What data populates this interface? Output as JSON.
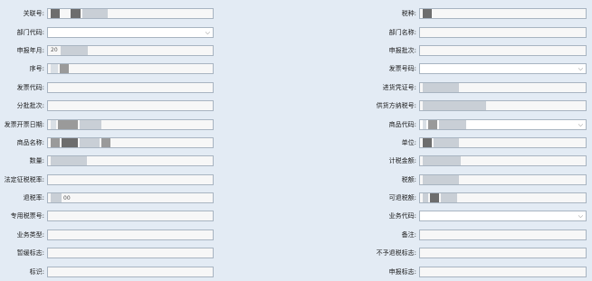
{
  "left_fields": [
    {
      "key": "customs_no",
      "label": "关联号:",
      "type": "text",
      "value": ""
    },
    {
      "key": "dept_code",
      "label": "部门代码:",
      "type": "select",
      "value": ""
    },
    {
      "key": "report_month",
      "label": "申报年月:",
      "type": "text",
      "value": "20"
    },
    {
      "key": "seq_no",
      "label": "序号:",
      "type": "text",
      "value": ""
    },
    {
      "key": "invoice_code",
      "label": "发票代码:",
      "type": "text",
      "value": ""
    },
    {
      "key": "batch_no",
      "label": "分批批次:",
      "type": "text",
      "value": ""
    },
    {
      "key": "invoice_date",
      "label": "发票开票日期:",
      "type": "text",
      "value": ""
    },
    {
      "key": "product_name",
      "label": "商品名称:",
      "type": "text",
      "value": ""
    },
    {
      "key": "quantity",
      "label": "数量:",
      "type": "text",
      "value": ""
    },
    {
      "key": "legal_tax_rate",
      "label": "法定征税税率:",
      "type": "text",
      "value": ""
    },
    {
      "key": "refund_rate",
      "label": "退税率:",
      "type": "text",
      "value": "00"
    },
    {
      "key": "special_ticket_no",
      "label": "专用税票号:",
      "type": "text",
      "value": ""
    },
    {
      "key": "business_type",
      "label": "业务类型:",
      "type": "text",
      "value": ""
    },
    {
      "key": "temp_flag",
      "label": "暂缓标志:",
      "type": "text",
      "value": ""
    },
    {
      "key": "mark",
      "label": "标识:",
      "type": "text",
      "value": ""
    }
  ],
  "right_fields": [
    {
      "key": "tax_type",
      "label": "税种:",
      "type": "text",
      "value": ""
    },
    {
      "key": "dept_name",
      "label": "部门名称:",
      "type": "text",
      "value": ""
    },
    {
      "key": "report_batch",
      "label": "申报批次:",
      "type": "text",
      "value": ""
    },
    {
      "key": "invoice_no",
      "label": "发票号码:",
      "type": "select",
      "value": ""
    },
    {
      "key": "import_voucher_no",
      "label": "进货凭证号:",
      "type": "text",
      "value": ""
    },
    {
      "key": "supplier_tax_id",
      "label": "供货方纳税号:",
      "type": "text",
      "value": ""
    },
    {
      "key": "product_code",
      "label": "商品代码:",
      "type": "select",
      "value": ""
    },
    {
      "key": "unit",
      "label": "单位:",
      "type": "text",
      "value": ""
    },
    {
      "key": "tax_amount",
      "label": "计税金额:",
      "type": "text",
      "value": ""
    },
    {
      "key": "tax",
      "label": "税额:",
      "type": "text",
      "value": ""
    },
    {
      "key": "refundable_tax",
      "label": "可退税额:",
      "type": "text",
      "value": ""
    },
    {
      "key": "business_code",
      "label": "业务代码:",
      "type": "select",
      "value": ""
    },
    {
      "key": "remark",
      "label": "备注:",
      "type": "text",
      "value": ""
    },
    {
      "key": "non_refund_flag",
      "label": "不予退税标志:",
      "type": "text",
      "value": ""
    },
    {
      "key": "report_flag",
      "label": "申报标志:",
      "type": "text",
      "value": ""
    }
  ],
  "icons": {
    "dropdown": "chevron-down-icon"
  }
}
